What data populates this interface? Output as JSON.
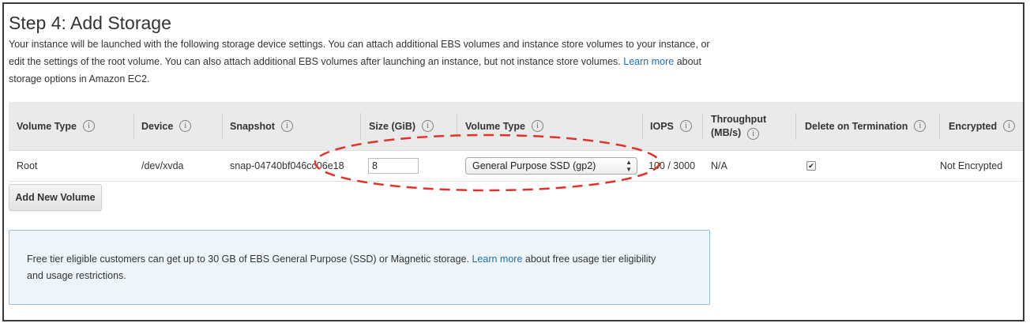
{
  "page": {
    "title": "Step 4: Add Storage",
    "description": "Your instance will be launched with the following storage device settings. You can attach additional EBS volumes and instance store volumes to your instance, or edit the settings of the root volume. You can also attach additional EBS volumes after launching an instance, but not instance store volumes.",
    "learn_more": "Learn more",
    "description_tail": "about storage options in Amazon EC2."
  },
  "table": {
    "headers": {
      "volume_type": "Volume Type",
      "device": "Device",
      "snapshot": "Snapshot",
      "size": "Size (GiB)",
      "volume_type2": "Volume Type",
      "iops": "IOPS",
      "throughput_line1": "Throughput",
      "throughput_line2": "(MB/s)",
      "delete_on_termination": "Delete on Termination",
      "encrypted": "Encrypted"
    },
    "info_glyph": "i",
    "row": {
      "volume_type": "Root",
      "device": "/dev/xvda",
      "snapshot": "snap-04740bf046cc06e18",
      "size": "8",
      "ebs_volume_type": "General Purpose SSD (gp2)",
      "iops": "100 / 3000",
      "throughput": "N/A",
      "delete_on_termination": true,
      "encrypted": "Not Encrypted"
    }
  },
  "buttons": {
    "add_new_volume": "Add New Volume"
  },
  "free_tier": {
    "text": "Free tier eligible customers can get up to 30 GB of EBS General Purpose (SSD) or Magnetic storage.",
    "learn_more": "Learn more",
    "text_tail": "about free usage tier eligibility and usage restrictions."
  },
  "colors": {
    "link": "#1a6fb7",
    "annotation": "#e0342a",
    "header_bg": "#eaeaea",
    "infobox_bg": "#eef6fc",
    "infobox_border": "#99c0de"
  },
  "icons": {
    "info": "info-circle-icon",
    "select_arrows": "updown-chevron-icon",
    "checkbox": "checkmark-icon"
  }
}
